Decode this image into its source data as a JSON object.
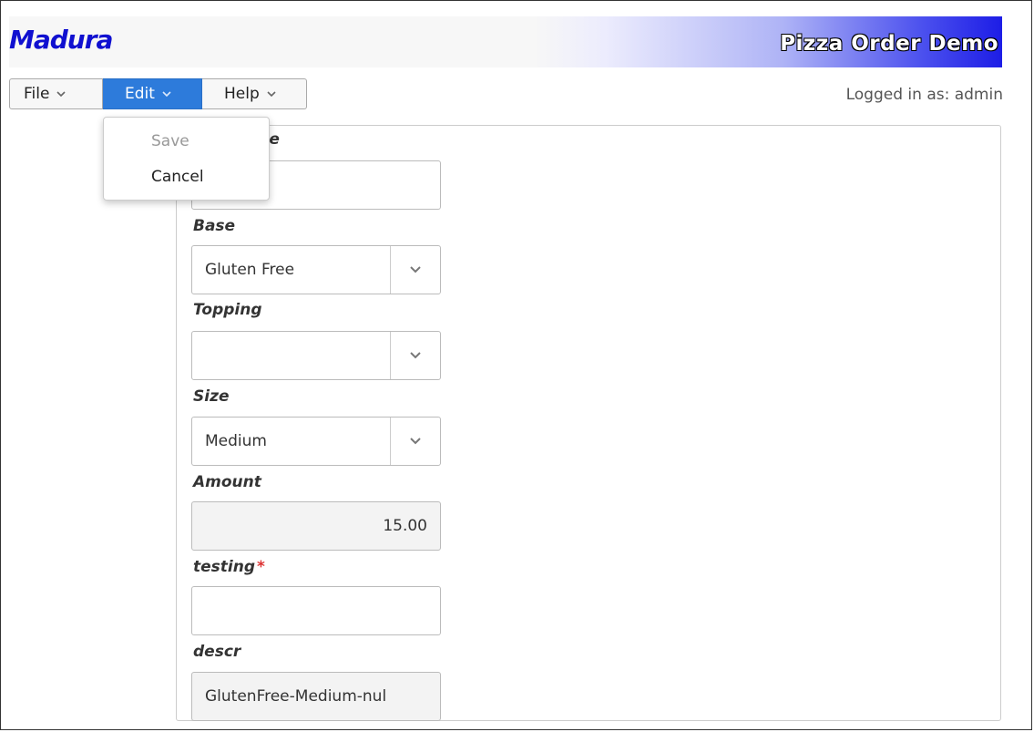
{
  "header": {
    "logo": "Madura",
    "title": "Pizza Order Demo"
  },
  "menubar": {
    "file_label": "File",
    "edit_label": "Edit",
    "help_label": "Help"
  },
  "status": {
    "logged_in": "Logged in as: admin"
  },
  "edit_menu": {
    "items": [
      {
        "label": "Save",
        "disabled": true
      },
      {
        "label": "Cancel",
        "disabled": false
      }
    ]
  },
  "form": {
    "name_label": "ome",
    "name_value": "",
    "base_label": "Base",
    "base_value": "Gluten Free",
    "topping_label": "Topping",
    "topping_value": "",
    "size_label": "Size",
    "size_value": "Medium",
    "amount_label": "Amount",
    "amount_value": "15.00",
    "testing_label": "testing",
    "testing_required": "*",
    "testing_value": "",
    "descr_label": "descr",
    "descr_value": "GlutenFree-Medium-nul"
  },
  "colors": {
    "accent": "#2d7bdb",
    "logo": "#1010d0",
    "header_gradient_end": "#1d1de6"
  }
}
